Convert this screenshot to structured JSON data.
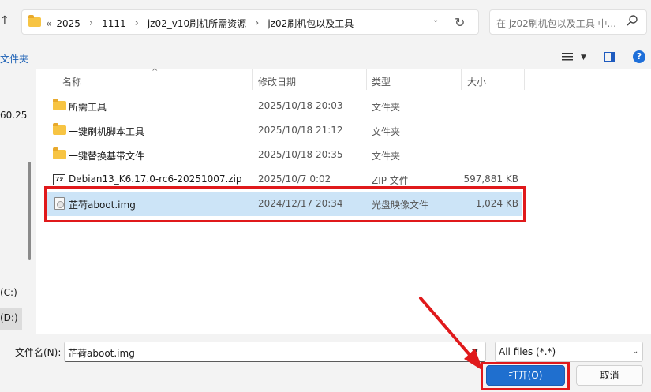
{
  "address": {
    "breadcrumbs": [
      "2025",
      "1111",
      "jz02_v10刷机所需资源",
      "jz02刷机包以及工具"
    ],
    "overflow_label": "«"
  },
  "search": {
    "placeholder": "在 jz02刷机包以及工具 中..."
  },
  "toolbar": {
    "new_folder_label": "文件夹"
  },
  "nav": {
    "items": [
      "60.25",
      "(C:)",
      "(D:)"
    ]
  },
  "columns": {
    "name": "名称",
    "date": "修改日期",
    "type": "类型",
    "size": "大小"
  },
  "files": [
    {
      "name": "所需工具",
      "date": "2025/10/18 20:03",
      "type": "文件夹",
      "size": "",
      "icon": "folder-icon"
    },
    {
      "name": "一键刷机脚本工具",
      "date": "2025/10/18 21:12",
      "type": "文件夹",
      "size": "",
      "icon": "folder-icon"
    },
    {
      "name": "一键替换基带文件",
      "date": "2025/10/18 20:35",
      "type": "文件夹",
      "size": "",
      "icon": "folder-icon"
    },
    {
      "name": "Debian13_K6.17.0-rc6-20251007.zip",
      "date": "2025/10/7 0:02",
      "type": "ZIP 文件",
      "size": "597,881 KB",
      "icon": "zip-icon"
    },
    {
      "name": "芷荷aboot.img",
      "date": "2024/12/17 20:34",
      "type": "光盘映像文件",
      "size": "1,024 KB",
      "icon": "disc-image-icon",
      "selected": true
    }
  ],
  "footer": {
    "filename_label": "文件名(N):",
    "filename_value": "芷荷aboot.img",
    "filetype_value": "All files (*.*)",
    "open_label": "打开(O)",
    "cancel_label": "取消"
  },
  "colors": {
    "accent": "#1f6fcf",
    "annotation": "#e0191b",
    "selection": "#cce4f7"
  },
  "zip_icon_text": "7z"
}
